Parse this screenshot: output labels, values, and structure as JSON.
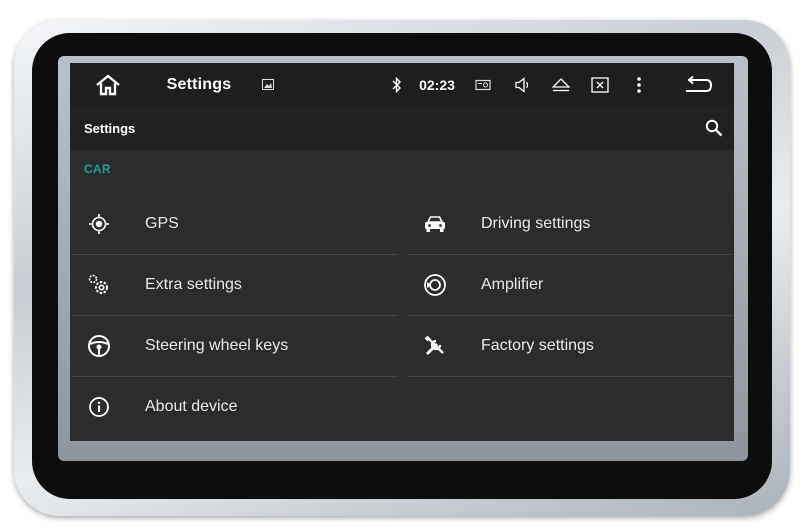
{
  "statusbar": {
    "title": "Settings",
    "time": "02:23",
    "icons": [
      "home-icon",
      "image-icon",
      "bluetooth-icon",
      "radio-icon",
      "volume-icon",
      "eject-icon",
      "close-window-icon",
      "more-vert-icon",
      "back-icon"
    ]
  },
  "appbar": {
    "title": "Settings",
    "search_icon": "search-icon"
  },
  "section": {
    "label": "CAR"
  },
  "items": [
    {
      "label": "GPS",
      "icon": "gps-icon"
    },
    {
      "label": "Driving settings",
      "icon": "car-icon"
    },
    {
      "label": "Extra settings",
      "icon": "extra-settings-icon"
    },
    {
      "label": "Amplifier",
      "icon": "amplifier-icon"
    },
    {
      "label": "Steering wheel keys",
      "icon": "steering-wheel-icon"
    },
    {
      "label": "Factory settings",
      "icon": "tools-icon"
    },
    {
      "label": "About device",
      "icon": "info-icon"
    }
  ],
  "colors": {
    "accent": "#1aa196",
    "screen_bg": "#2c2c2c",
    "statusbar_bg": "#1e1e1e"
  }
}
